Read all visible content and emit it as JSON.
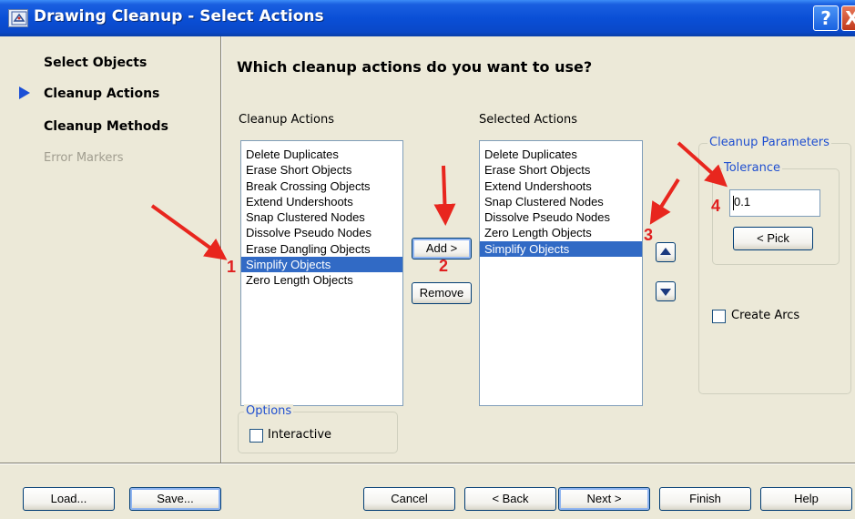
{
  "window": {
    "title": "Drawing Cleanup - Select Actions",
    "help_label": "?",
    "close_label": "X"
  },
  "nav": {
    "items": [
      {
        "label": "Select Objects"
      },
      {
        "label": "Cleanup Actions"
      },
      {
        "label": "Cleanup Methods"
      },
      {
        "label": "Error Markers"
      }
    ]
  },
  "main": {
    "question": "Which cleanup actions do you want to use?",
    "available_label": "Cleanup Actions",
    "selected_label": "Selected Actions",
    "available_items": [
      "Delete Duplicates",
      "Erase Short Objects",
      "Break Crossing Objects",
      "Extend Undershoots",
      "Snap Clustered Nodes",
      "Dissolve Pseudo Nodes",
      "Erase Dangling Objects",
      "Simplify Objects",
      "Zero Length Objects"
    ],
    "available_selected": "Simplify Objects",
    "selected_items": [
      "Delete Duplicates",
      "Erase Short Objects",
      "Extend Undershoots",
      "Snap Clustered Nodes",
      "Dissolve Pseudo Nodes",
      "Zero Length Objects",
      "Simplify Objects"
    ],
    "selected_selected": "Simplify Objects",
    "add_label": "Add >",
    "remove_label": "Remove",
    "options_title": "Options",
    "interactive_label": "Interactive"
  },
  "params": {
    "group_title": "Cleanup Parameters",
    "tolerance_title": "Tolerance",
    "tolerance_value": "0.1",
    "pick_label": "< Pick",
    "create_arcs_label": "Create Arcs"
  },
  "annotations": [
    "1",
    "2",
    "3",
    "4"
  ],
  "footer": {
    "load": "Load...",
    "save": "Save...",
    "cancel": "Cancel",
    "back": "< Back",
    "next": "Next >",
    "finish": "Finish",
    "help": "Help"
  },
  "colors": {
    "selection": "#316ac5",
    "titlebar": "#0a4fd6",
    "annotation": "#e02020",
    "nav_arrow": "#1b4fd6"
  }
}
